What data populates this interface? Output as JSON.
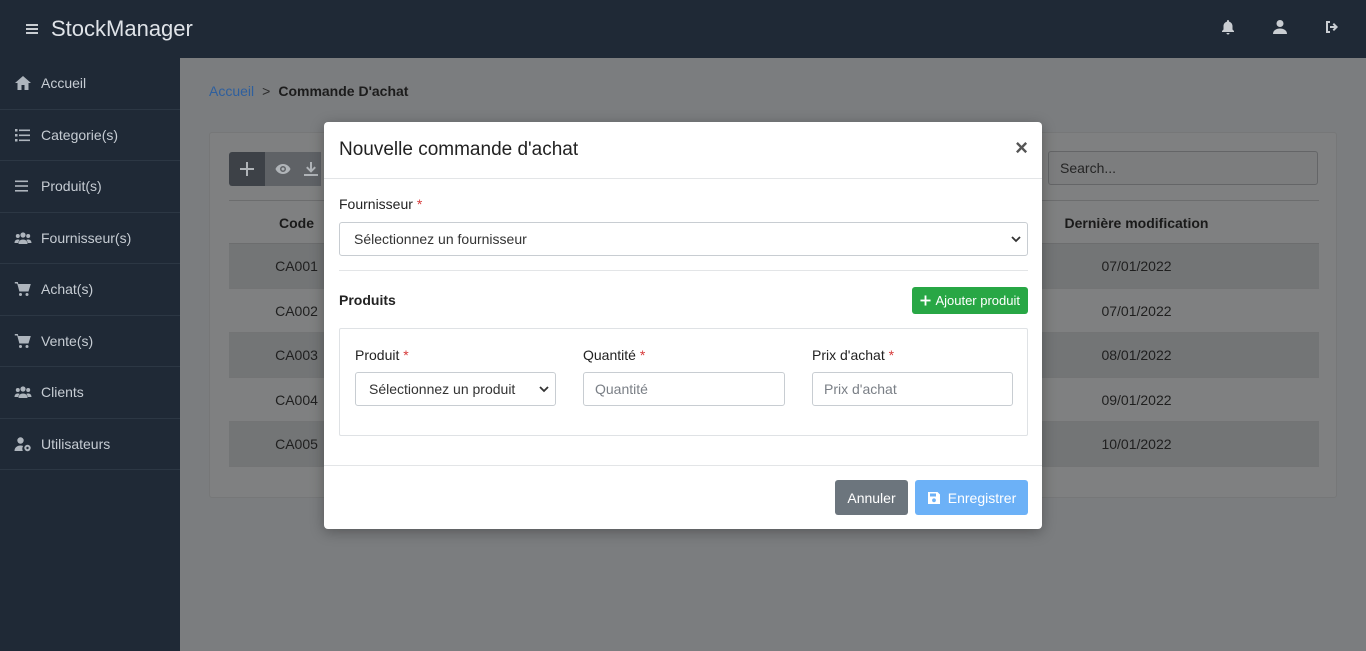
{
  "app": {
    "brand": "StockManager"
  },
  "topbar": {
    "icons": [
      "bell-icon",
      "user-icon",
      "sign-out-icon"
    ]
  },
  "sidebar": {
    "items": [
      {
        "label": "Accueil",
        "icon": "home-icon"
      },
      {
        "label": "Categorie(s)",
        "icon": "list-icon"
      },
      {
        "label": "Produit(s)",
        "icon": "bars-icon"
      },
      {
        "label": "Fournisseur(s)",
        "icon": "users-icon"
      },
      {
        "label": "Achat(s)",
        "icon": "cart-icon"
      },
      {
        "label": "Vente(s)",
        "icon": "cart-icon"
      },
      {
        "label": "Clients",
        "icon": "users-icon"
      },
      {
        "label": "Utilisateurs",
        "icon": "user-cog-icon"
      }
    ]
  },
  "breadcrumb": {
    "home": "Accueil",
    "separator": ">",
    "current": "Commande D'achat"
  },
  "search": {
    "placeholder": "Search..."
  },
  "table": {
    "headers": {
      "code": "Code",
      "modified": "Dernière modification"
    },
    "rows": [
      {
        "code": "CA001",
        "modified": "07/01/2022"
      },
      {
        "code": "CA002",
        "modified": "07/01/2022"
      },
      {
        "code": "CA003",
        "modified": "08/01/2022"
      },
      {
        "code": "CA004",
        "modified": "09/01/2022"
      },
      {
        "code": "CA005",
        "modified": "10/01/2022"
      }
    ]
  },
  "modal": {
    "title": "Nouvelle commande d'achat",
    "close": "×",
    "supplier_label": "Fournisseur",
    "required_mark": "*",
    "supplier_select": "Sélectionnez un fournisseur",
    "products_title": "Produits",
    "add_product": "Ajouter produit",
    "product_label": "Produit",
    "product_select": "Sélectionnez un produit",
    "quantity_label": "Quantité",
    "quantity_placeholder": "Quantité",
    "price_label": "Prix d'achat",
    "price_placeholder": "Prix d'achat",
    "cancel": "Annuler",
    "save": "Enregistrer"
  }
}
